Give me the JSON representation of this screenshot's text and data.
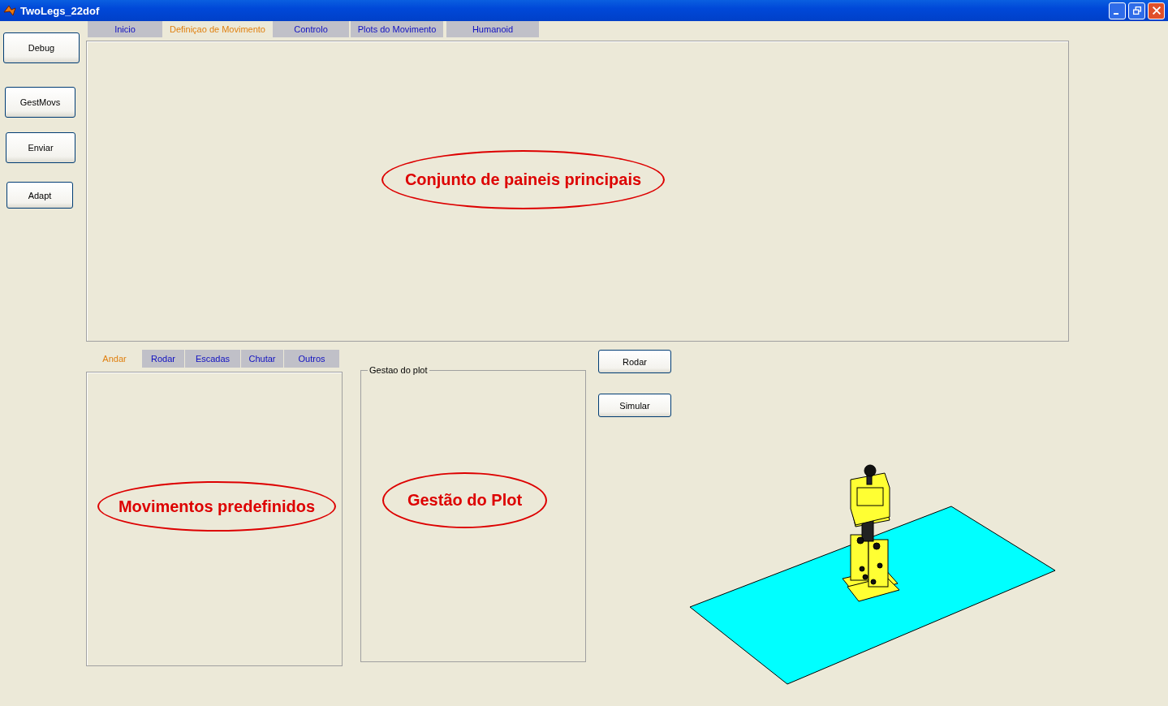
{
  "window": {
    "title": "TwoLegs_22dof"
  },
  "side_buttons": [
    "Debug",
    "GestMovs",
    "Enviar",
    "Adapt"
  ],
  "main_tabs": [
    {
      "label": "Inicio",
      "selected": false
    },
    {
      "label": "Definiçao de Movimento",
      "selected": true
    },
    {
      "label": "Controlo",
      "selected": false
    },
    {
      "label": "Plots do Movimento",
      "selected": false
    },
    {
      "label": "Humanoid",
      "selected": false
    }
  ],
  "main_panel": {
    "annotation": "Conjunto de paineis principais"
  },
  "movement_tabs": [
    {
      "label": "Andar",
      "selected": true
    },
    {
      "label": "Rodar",
      "selected": false
    },
    {
      "label": "Escadas",
      "selected": false
    },
    {
      "label": "Chutar",
      "selected": false
    },
    {
      "label": "Outros",
      "selected": false
    }
  ],
  "movement_panel": {
    "annotation": "Movimentos predefinidos"
  },
  "plot_panel": {
    "title": "Gestao do plot",
    "annotation": "Gestão do Plot"
  },
  "action_buttons": [
    "Rodar",
    "Simular"
  ]
}
